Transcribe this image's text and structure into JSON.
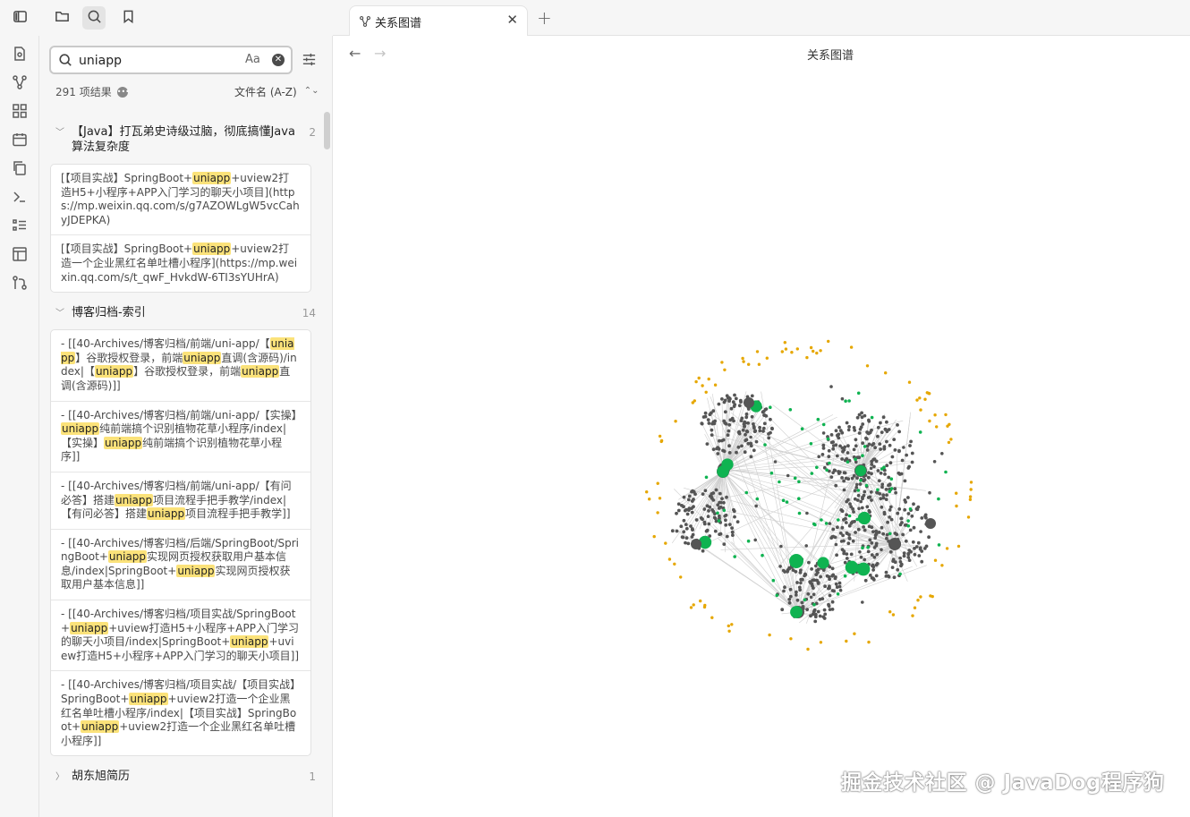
{
  "tabs": [
    {
      "label": "关系图谱"
    }
  ],
  "view": {
    "title": "关系图谱"
  },
  "search": {
    "query": "uniapp",
    "match_case_label": "Aa",
    "result_count": "291 项结果",
    "sort": "文件名 (A-Z)"
  },
  "results": [
    {
      "title": "【Java】打瓦弟史诗级过脑，彻底搞懂Java算法复杂度",
      "count": "2",
      "expanded": true,
      "matches": [
        [
          {
            "t": "[【项目实战】SpringBoot+"
          },
          {
            "t": "uniapp",
            "h": true
          },
          {
            "t": "+uview2打造H5+小程序+APP入门学习的聊天小项目](https://mp.weixin.qq.com/s/g7AZOWLgW5vcCahyJDEPKA)"
          }
        ],
        [
          {
            "t": "[【项目实战】SpringBoot+"
          },
          {
            "t": "uniapp",
            "h": true
          },
          {
            "t": "+uview2打造一个企业黑红名单吐槽小程序](https://mp.weixin.qq.com/s/t_qwF_HvkdW-6TI3sYUHrA)"
          }
        ]
      ]
    },
    {
      "title": "博客归档-索引",
      "count": "14",
      "expanded": true,
      "matches": [
        [
          {
            "t": "- [[40-Archives/博客归档/前端/uni-app/【"
          },
          {
            "t": "uniapp",
            "h": true
          },
          {
            "t": "】谷歌授权登录，前端"
          },
          {
            "t": "uniapp",
            "h": true
          },
          {
            "t": "直调(含源码)/index|【"
          },
          {
            "t": "uniapp",
            "h": true
          },
          {
            "t": "】谷歌授权登录，前端"
          },
          {
            "t": "uniapp",
            "h": true
          },
          {
            "t": "直调(含源码)]]"
          }
        ],
        [
          {
            "t": "- [[40-Archives/博客归档/前端/uni-app/【实操】"
          },
          {
            "t": "uniapp",
            "h": true
          },
          {
            "t": "纯前端搞个识别植物花草小程序/index|【实操】"
          },
          {
            "t": "uniapp",
            "h": true
          },
          {
            "t": "纯前端搞个识别植物花草小程序]]"
          }
        ],
        [
          {
            "t": "- [[40-Archives/博客归档/前端/uni-app/【有问必答】搭建"
          },
          {
            "t": "uniapp",
            "h": true
          },
          {
            "t": "项目流程手把手教学/index|【有问必答】搭建"
          },
          {
            "t": "uniapp",
            "h": true
          },
          {
            "t": "项目流程手把手教学]]"
          }
        ],
        [
          {
            "t": "- [[40-Archives/博客归档/后端/SpringBoot/SpringBoot+"
          },
          {
            "t": "uniapp",
            "h": true
          },
          {
            "t": "实现网页授权获取用户基本信息/index|SpringBoot+"
          },
          {
            "t": "uniapp",
            "h": true
          },
          {
            "t": "实现网页授权获取用户基本信息]]"
          }
        ],
        [
          {
            "t": "- [[40-Archives/博客归档/项目实战/SpringBoot+"
          },
          {
            "t": "uniapp",
            "h": true
          },
          {
            "t": "+uview打造H5+小程序+APP入门学习的聊天小项目/index|SpringBoot+"
          },
          {
            "t": "uniapp",
            "h": true
          },
          {
            "t": "+uview打造H5+小程序+APP入门学习的聊天小项目]]"
          }
        ],
        [
          {
            "t": "- [[40-Archives/博客归档/项目实战/【项目实战】SpringBoot+"
          },
          {
            "t": "uniapp",
            "h": true
          },
          {
            "t": "+uview2打造一个企业黑红名单吐槽小程序/index|【项目实战】SpringBoot+"
          },
          {
            "t": "uniapp",
            "h": true
          },
          {
            "t": "+uview2打造一个企业黑红名单吐槽小程序]]"
          }
        ]
      ]
    },
    {
      "title": "胡东旭简历",
      "count": "1",
      "expanded": false,
      "matches": []
    }
  ],
  "graph": {
    "colors": {
      "node": "#555555",
      "match": "#0fb351",
      "orphan": "#e6a700",
      "edge": "#cfcfcf"
    }
  },
  "watermark": "掘金技术社区 @ JavaDog程序狗"
}
